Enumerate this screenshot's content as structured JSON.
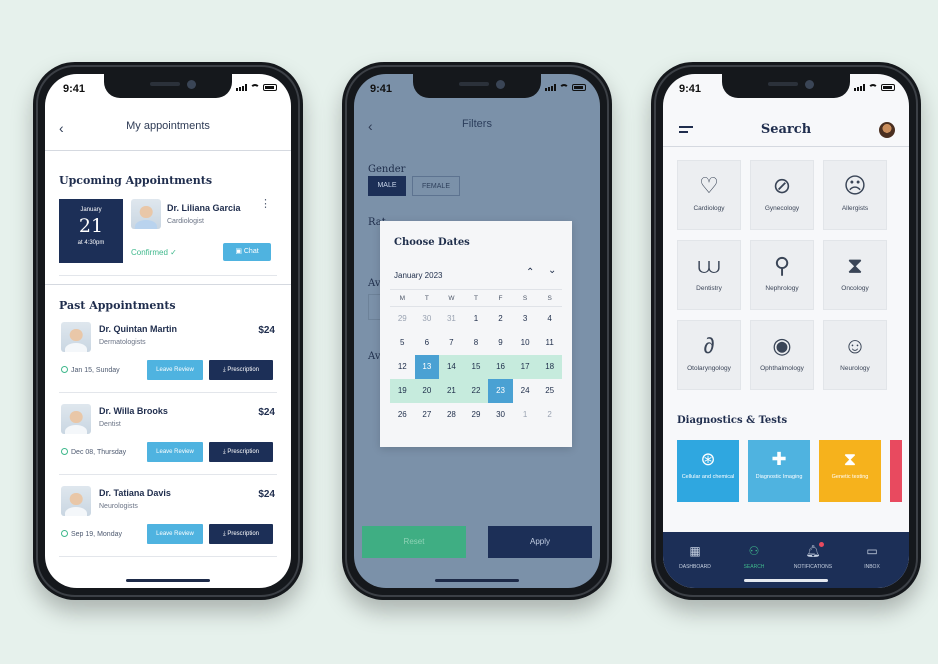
{
  "status_time": "9:41",
  "phone1": {
    "title": "My appointments",
    "upcoming_title": "Upcoming Appointments",
    "upcoming": {
      "month": "January",
      "day": "21",
      "time": "at 4:30pm",
      "doctor": "Dr. Liliana Garcia",
      "specialty": "Cardiologist",
      "status": "Confirmed ✓",
      "chat_label": "Chat"
    },
    "past_title": "Past Appointments",
    "past": [
      {
        "doctor": "Dr. Quintan Martin",
        "specialty": "Dermatologists",
        "price": "$24",
        "date": "Jan 15, Sunday",
        "review": "Leave Review",
        "prescription": "Prescription"
      },
      {
        "doctor": "Dr. Willa Brooks",
        "specialty": "Dentist",
        "price": "$24",
        "date": "Dec 08, Thursday",
        "review": "Leave Review",
        "prescription": "Prescription"
      },
      {
        "doctor": "Dr. Tatiana Davis",
        "specialty": "Neurologists",
        "price": "$24",
        "date": "Sep 19, Monday",
        "review": "Leave Review",
        "prescription": "Prescription"
      }
    ]
  },
  "phone2": {
    "title": "Filters",
    "gender_label": "Gender",
    "male": "MALE",
    "female": "FEMALE",
    "partial_labels": [
      "Rat",
      "Ava",
      "Ava"
    ],
    "calendar": {
      "title": "Choose Dates",
      "month": "January 2023",
      "weekdays": [
        "M",
        "T",
        "W",
        "T",
        "F",
        "S",
        "S"
      ],
      "weeks": [
        [
          "29",
          "30",
          "31",
          "1",
          "2",
          "3",
          "4"
        ],
        [
          "5",
          "6",
          "7",
          "8",
          "9",
          "10",
          "11"
        ],
        [
          "12",
          "13",
          "14",
          "15",
          "16",
          "17",
          "18"
        ],
        [
          "19",
          "20",
          "21",
          "22",
          "23",
          "24",
          "25"
        ],
        [
          "26",
          "27",
          "28",
          "29",
          "30",
          "1",
          "2"
        ]
      ],
      "range_start": "13",
      "range_end": "23"
    },
    "reset": "Reset",
    "apply": "Apply"
  },
  "phone3": {
    "title": "Search",
    "specialties": [
      {
        "label": "Cardiology",
        "icon": "heart-icon"
      },
      {
        "label": "Gynecology",
        "icon": "uterus-icon"
      },
      {
        "label": "Allergists",
        "icon": "face-icon"
      },
      {
        "label": "Dentistry",
        "icon": "teeth-icon"
      },
      {
        "label": "Nephrology",
        "icon": "kidney-icon"
      },
      {
        "label": "Oncology",
        "icon": "dna-icon"
      },
      {
        "label": "Otolaryngology",
        "icon": "ear-icon"
      },
      {
        "label": "Ophthalmology",
        "icon": "eye-icon"
      },
      {
        "label": "Neurology",
        "icon": "head-icon"
      }
    ],
    "diagnostics_title": "Diagnostics & Tests",
    "diagnostics": [
      {
        "label": "Cellular and chemical",
        "color": "#2fa7e0"
      },
      {
        "label": "Diagnostic Imaging",
        "color": "#4fb3e0"
      },
      {
        "label": "Genetic testing",
        "color": "#f6b21c"
      },
      {
        "label": "",
        "color": "#e84a5f"
      }
    ],
    "tabs": [
      {
        "label": "DASHBOARD",
        "icon": "grid-icon"
      },
      {
        "label": "SEARCH",
        "icon": "search-icon"
      },
      {
        "label": "NOTIFICATIONS",
        "icon": "bell-icon"
      },
      {
        "label": "INBOX",
        "icon": "chat-icon"
      }
    ]
  },
  "colors": {
    "navy": "#1c2f57",
    "accent_blue": "#4fb3e0",
    "accent_green": "#3fb88c",
    "background": "#e6f1ec"
  }
}
